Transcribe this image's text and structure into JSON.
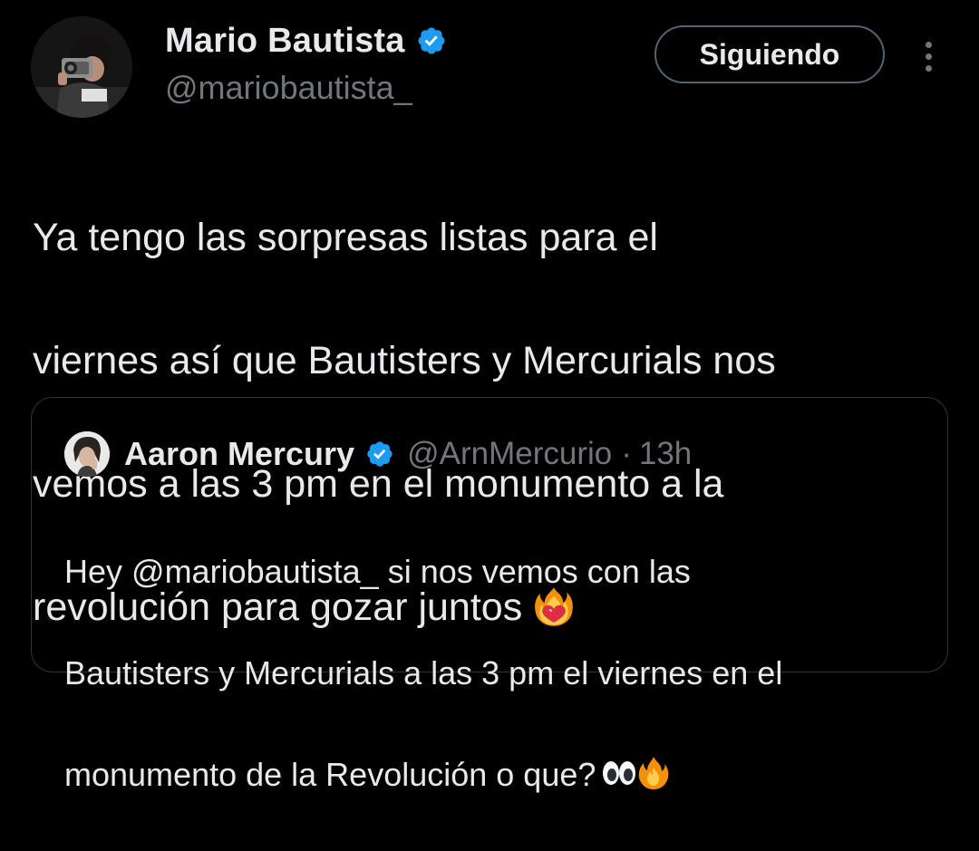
{
  "author": {
    "name": "Mario Bautista",
    "handle": "@mariobautista_",
    "verified": true,
    "avatar_icon": "profile-photo-camera"
  },
  "actions": {
    "follow_label": "Siguiendo",
    "more_icon": "more-vertical-icon"
  },
  "tweet": {
    "text_line_1": "Ya tengo las sorpresas listas para el",
    "text_line_2": "viernes así que Bautisters y Mercurials nos",
    "text_line_3": "vemos a las 3 pm en el monumento a la",
    "text_line_4": "revolución para gozar juntos",
    "emoji": "heart-on-fire-emoji"
  },
  "quoted_tweet": {
    "author_name": "Aaron Mercury",
    "author_handle": "@ArnMercurio",
    "separator": "·",
    "time": "13h",
    "verified": true,
    "text_line_1": "Hey @mariobautista_ si nos vemos con las",
    "text_line_2": "Bautisters y Mercurials a las 3 pm el viernes en el",
    "text_line_3": "monumento de la Revolución o que?",
    "emojis": [
      "eyes-emoji",
      "fire-emoji"
    ]
  },
  "colors": {
    "background": "#000000",
    "text_primary": "#e7e9ea",
    "text_secondary": "#71767b",
    "verified_blue": "#1d9bf0",
    "border": "#2f3336",
    "button_border": "#536471"
  }
}
